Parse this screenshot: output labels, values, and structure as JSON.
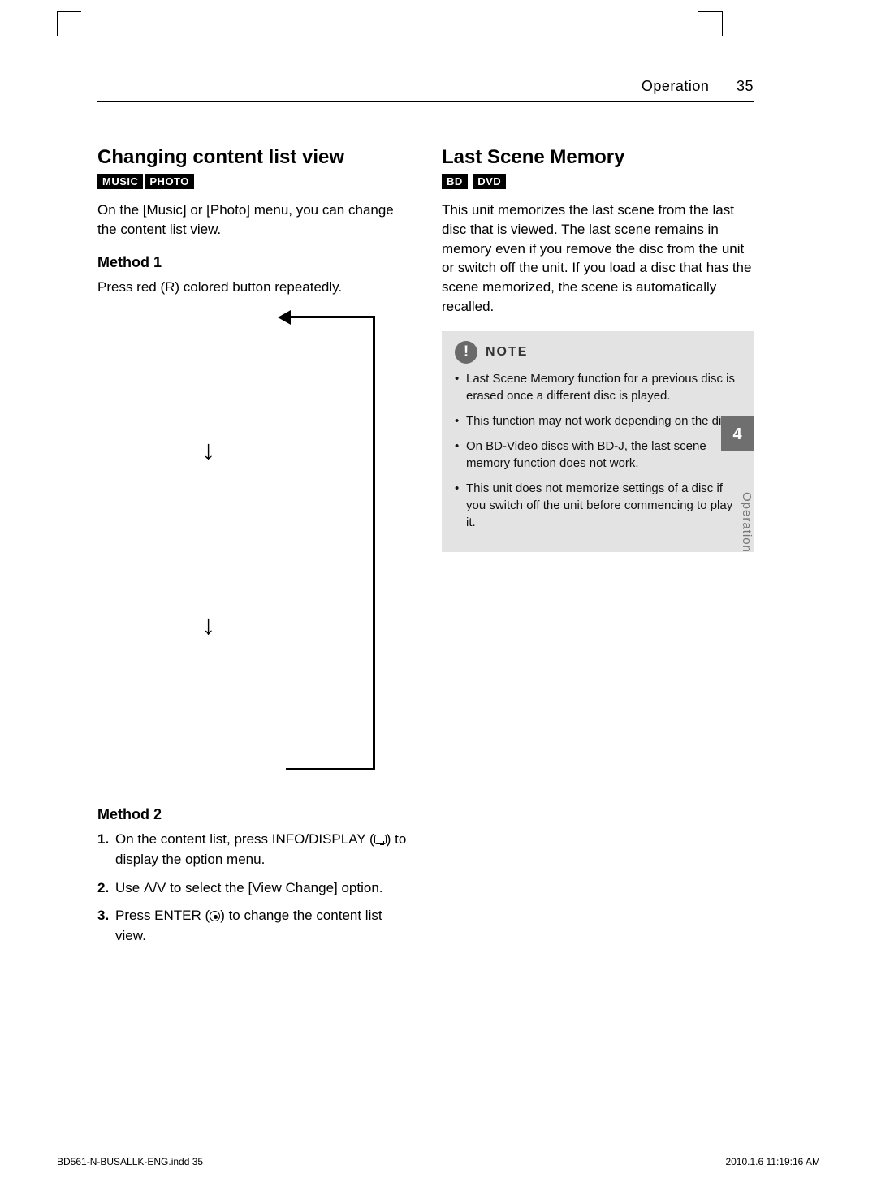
{
  "header": {
    "section": "Operation",
    "page_number": "35"
  },
  "left": {
    "heading": "Changing content list view",
    "badges": [
      "MUSIC",
      "PHOTO"
    ],
    "intro": "On the [Music] or [Photo] menu, you can change the content list view.",
    "method1_title": "Method 1",
    "method1_text": "Press red (R) colored button repeatedly.",
    "method2_title": "Method 2",
    "method2_steps": {
      "s1a": "On the content list, press INFO/DISPLAY (",
      "s1b": ") to display the option menu.",
      "s2": "Use Λ/V to select the [View Change] option.",
      "s3a": "Press ENTER (",
      "s3b": ") to change the content list view."
    }
  },
  "right": {
    "heading": "Last Scene Memory",
    "badges": [
      "BD",
      "DVD"
    ],
    "body": "This unit memorizes the last scene from the last disc that is viewed. The last scene remains in memory even if you remove the disc from the unit or switch off the unit. If you load a disc that has the scene memorized, the scene is automatically recalled.",
    "note_label": "NOTE",
    "notes": [
      "Last Scene Memory function for a previous disc is erased once a different disc is played.",
      "This function may not work depending on the disc.",
      "On BD-Video discs with BD-J, the last scene memory function does not work.",
      "This unit does not memorize settings of a disc if you switch off the unit before commencing to play it."
    ]
  },
  "side_tab": {
    "number": "4",
    "label": "Operation"
  },
  "footer": {
    "left": "BD561-N-BUSALLK-ENG.indd   35",
    "right": "2010.1.6   11:19:16 AM"
  }
}
